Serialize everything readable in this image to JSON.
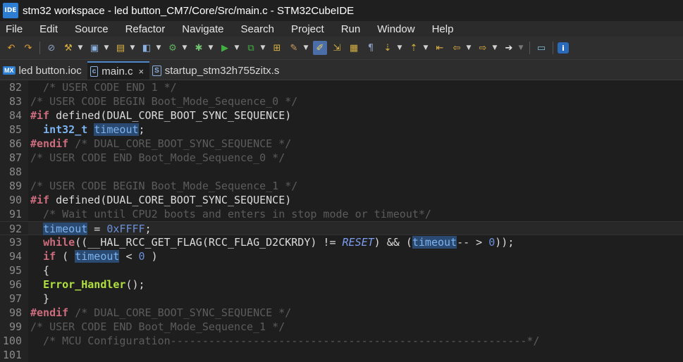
{
  "window": {
    "icon_label": "IDE",
    "title": "stm32 workspace - led button_CM7/Core/Src/main.c - STM32CubeIDE"
  },
  "menu": [
    "File",
    "Edit",
    "Source",
    "Refactor",
    "Navigate",
    "Search",
    "Project",
    "Run",
    "Window",
    "Help"
  ],
  "tabs": [
    {
      "icon": "MX",
      "label": "led button.ioc"
    },
    {
      "icon": "c",
      "label": "main.c",
      "close": "×"
    },
    {
      "icon": "S",
      "label": "startup_stm32h755zitx.s"
    }
  ],
  "editor": {
    "current_line": 92,
    "lines": [
      {
        "n": "82",
        "tokens": [
          {
            "t": "  /* USER CODE END 1 */",
            "c": "cm"
          }
        ]
      },
      {
        "n": "83",
        "tokens": [
          {
            "t": "/* USER CODE BEGIN Boot_Mode_Sequence_0 */",
            "c": "cm"
          }
        ]
      },
      {
        "n": "84",
        "tokens": [
          {
            "t": "#if",
            "c": "kw"
          },
          {
            "t": " defined(DUAL_CORE_BOOT_SYNC_SEQUENCE)",
            "c": ""
          }
        ]
      },
      {
        "n": "85",
        "tokens": [
          {
            "t": "  ",
            "c": ""
          },
          {
            "t": "int32_t",
            "c": "ty"
          },
          {
            "t": " ",
            "c": ""
          },
          {
            "t": "timeout",
            "c": "hl"
          },
          {
            "t": ";",
            "c": ""
          }
        ]
      },
      {
        "n": "86",
        "tokens": [
          {
            "t": "#endif",
            "c": "kw"
          },
          {
            "t": " /* DUAL_CORE_BOOT_SYNC_SEQUENCE */",
            "c": "cm"
          }
        ]
      },
      {
        "n": "87",
        "tokens": [
          {
            "t": "/* USER CODE END Boot_Mode_Sequence_0 */",
            "c": "cm"
          }
        ]
      },
      {
        "n": "88",
        "tokens": [
          {
            "t": "",
            "c": ""
          }
        ]
      },
      {
        "n": "89",
        "tokens": [
          {
            "t": "/* USER CODE BEGIN Boot_Mode_Sequence_1 */",
            "c": "cm"
          }
        ]
      },
      {
        "n": "90",
        "tokens": [
          {
            "t": "#if",
            "c": "kw"
          },
          {
            "t": " defined(DUAL_CORE_BOOT_SYNC_SEQUENCE)",
            "c": ""
          }
        ]
      },
      {
        "n": "91",
        "tokens": [
          {
            "t": "  /* Wait until CPU2 boots and enters in stop mode or timeout*/",
            "c": "cm"
          }
        ]
      },
      {
        "n": "92",
        "tokens": [
          {
            "t": "  ",
            "c": ""
          },
          {
            "t": "timeout",
            "c": "hl"
          },
          {
            "t": " = ",
            "c": ""
          },
          {
            "t": "0xFFFF",
            "c": "num"
          },
          {
            "t": ";",
            "c": ""
          }
        ]
      },
      {
        "n": "93",
        "tokens": [
          {
            "t": "  ",
            "c": ""
          },
          {
            "t": "while",
            "c": "kw"
          },
          {
            "t": "((__HAL_RCC_GET_FLAG(RCC_FLAG_D2CKRDY) != ",
            "c": ""
          },
          {
            "t": "RESET",
            "c": "italic"
          },
          {
            "t": ") && (",
            "c": ""
          },
          {
            "t": "timeout",
            "c": "hl"
          },
          {
            "t": "-- > ",
            "c": ""
          },
          {
            "t": "0",
            "c": "num"
          },
          {
            "t": "));",
            "c": ""
          }
        ]
      },
      {
        "n": "94",
        "tokens": [
          {
            "t": "  ",
            "c": ""
          },
          {
            "t": "if",
            "c": "kw"
          },
          {
            "t": " ( ",
            "c": ""
          },
          {
            "t": "timeout",
            "c": "hl"
          },
          {
            "t": " < ",
            "c": ""
          },
          {
            "t": "0",
            "c": "num"
          },
          {
            "t": " )",
            "c": ""
          }
        ]
      },
      {
        "n": "95",
        "tokens": [
          {
            "t": "  {",
            "c": ""
          }
        ]
      },
      {
        "n": "96",
        "tokens": [
          {
            "t": "  ",
            "c": ""
          },
          {
            "t": "Error_Handler",
            "c": "fn"
          },
          {
            "t": "();",
            "c": ""
          }
        ]
      },
      {
        "n": "97",
        "tokens": [
          {
            "t": "  }",
            "c": ""
          }
        ]
      },
      {
        "n": "98",
        "tokens": [
          {
            "t": "#endif",
            "c": "kw"
          },
          {
            "t": " /* DUAL_CORE_BOOT_SYNC_SEQUENCE */",
            "c": "cm"
          }
        ]
      },
      {
        "n": "99",
        "tokens": [
          {
            "t": "/* USER CODE END Boot_Mode_Sequence_1 */",
            "c": "cm"
          }
        ]
      },
      {
        "n": "100",
        "tokens": [
          {
            "t": "  /* MCU Configuration--------------------------------------------------------*/",
            "c": "cm"
          }
        ]
      },
      {
        "n": "101",
        "tokens": [
          {
            "t": "",
            "c": ""
          }
        ]
      }
    ]
  },
  "toolbar_icons": [
    "undo-icon",
    "redo-icon",
    "skip-breakpoints-icon",
    "build-icon",
    "new-c-project-icon",
    "new-source-folder-icon",
    "new-class-icon",
    "build-all-icon",
    "debug-icon",
    "run-icon",
    "external-tools-icon",
    "open-type-icon",
    "search-icon",
    "toggle-mark-occurrences-icon",
    "toggle-word-wrap-icon",
    "block-selection-icon",
    "show-whitespace-icon",
    "next-annotation-icon",
    "previous-annotation-icon",
    "last-edit-location-icon",
    "back-icon",
    "forward-icon",
    "pin-editor-icon",
    "perspective-icon",
    "info-icon"
  ]
}
